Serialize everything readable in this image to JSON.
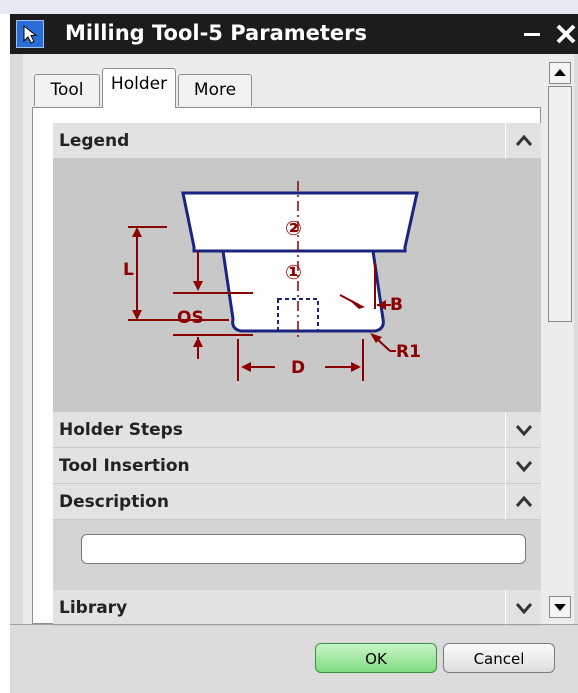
{
  "window": {
    "title": "Milling Tool-5 Parameters"
  },
  "tabs": [
    {
      "label": "Tool"
    },
    {
      "label": "Holder"
    },
    {
      "label": "More"
    }
  ],
  "sections": {
    "legend": "Legend",
    "holder_steps": "Holder Steps",
    "tool_insertion": "Tool Insertion",
    "description": "Description",
    "library": "Library"
  },
  "diagram_labels": {
    "step_2": "②",
    "step_1": "①",
    "L": "L",
    "OS": "OS",
    "B": "B",
    "D": "D",
    "R1": "R1"
  },
  "description_field": {
    "value": ""
  },
  "buttons": {
    "ok": "OK",
    "cancel": "Cancel"
  },
  "colors": {
    "title_bar": "#1c1c1c",
    "ok_button": "#7fdc7f",
    "diagram_outline": "#1a237e",
    "dimension_lines": "#8b0000"
  }
}
